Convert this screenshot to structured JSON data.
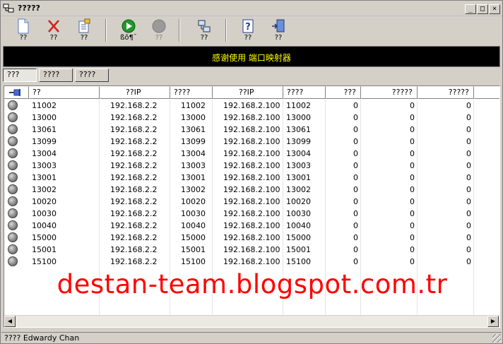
{
  "window": {
    "title": "?????"
  },
  "toolbar": [
    {
      "name": "new-button",
      "icon": "new-document-icon",
      "label": "??"
    },
    {
      "name": "delete-button",
      "icon": "delete-x-icon",
      "label": "??"
    },
    {
      "name": "edit-button",
      "icon": "edit-properties-icon",
      "label": "??"
    },
    {
      "name": "start-button",
      "icon": "play-icon",
      "label": "ßõ¶¯"
    },
    {
      "name": "stop-button",
      "icon": "stop-icon",
      "label": "??"
    },
    {
      "name": "network-button",
      "icon": "network-icon",
      "label": "??"
    },
    {
      "name": "help-button",
      "icon": "help-icon",
      "label": "??"
    },
    {
      "name": "exit-button",
      "icon": "exit-door-icon",
      "label": "??"
    }
  ],
  "banner": {
    "text": "感谢使用 端口映射器"
  },
  "tabs": [
    "???",
    "????",
    "????"
  ],
  "table": {
    "header_icon": "pin-icon",
    "columns": [
      "??",
      "??IP",
      "????",
      "??IP",
      "????",
      "???",
      "?????",
      "?????"
    ],
    "rows": [
      [
        "11002",
        "192.168.2.2",
        "11002",
        "192.168.2.100",
        "11002",
        "0",
        "0",
        "0"
      ],
      [
        "13000",
        "192.168.2.2",
        "13000",
        "192.168.2.100",
        "13000",
        "0",
        "0",
        "0"
      ],
      [
        "13061",
        "192.168.2.2",
        "13061",
        "192.168.2.100",
        "13061",
        "0",
        "0",
        "0"
      ],
      [
        "13099",
        "192.168.2.2",
        "13099",
        "192.168.2.100",
        "13099",
        "0",
        "0",
        "0"
      ],
      [
        "13004",
        "192.168.2.2",
        "13004",
        "192.168.2.100",
        "13004",
        "0",
        "0",
        "0"
      ],
      [
        "13003",
        "192.168.2.2",
        "13003",
        "192.168.2.100",
        "13003",
        "0",
        "0",
        "0"
      ],
      [
        "13001",
        "192.168.2.2",
        "13001",
        "192.168.2.100",
        "13001",
        "0",
        "0",
        "0"
      ],
      [
        "13002",
        "192.168.2.2",
        "13002",
        "192.168.2.100",
        "13002",
        "0",
        "0",
        "0"
      ],
      [
        "10020",
        "192.168.2.2",
        "10020",
        "192.168.2.100",
        "10020",
        "0",
        "0",
        "0"
      ],
      [
        "10030",
        "192.168.2.2",
        "10030",
        "192.168.2.100",
        "10030",
        "0",
        "0",
        "0"
      ],
      [
        "10040",
        "192.168.2.2",
        "10040",
        "192.168.2.100",
        "10040",
        "0",
        "0",
        "0"
      ],
      [
        "15000",
        "192.168.2.2",
        "15000",
        "192.168.2.100",
        "15000",
        "0",
        "0",
        "0"
      ],
      [
        "15001",
        "192.168.2.2",
        "15001",
        "192.168.2.100",
        "15001",
        "0",
        "0",
        "0"
      ],
      [
        "15100",
        "192.168.2.2",
        "15100",
        "192.168.2.100",
        "15100",
        "0",
        "0",
        "0"
      ]
    ]
  },
  "watermark": {
    "text": "destan-team.blogspot.com.tr"
  },
  "status": {
    "text": "???? Edwardy Chan"
  }
}
